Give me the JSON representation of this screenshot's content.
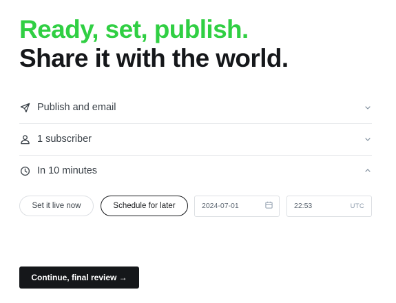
{
  "header": {
    "headline_accent": "Ready, set, publish.",
    "headline_main": "Share it with the world."
  },
  "settings": {
    "rows": [
      {
        "label": "Publish and email",
        "icon": "send-icon",
        "expanded": false
      },
      {
        "label": "1 subscriber",
        "icon": "user-icon",
        "expanded": false
      },
      {
        "label": "In 10 minutes",
        "icon": "clock-icon",
        "expanded": true
      }
    ]
  },
  "schedule": {
    "set_live_label": "Set it live now",
    "schedule_later_label": "Schedule for later",
    "selected": "Schedule for later",
    "date_value": "2024-07-01",
    "time_value": "22:53",
    "timezone": "UTC"
  },
  "actions": {
    "continue_label": "Continue, final review →"
  },
  "colors": {
    "accent": "#30cf43",
    "text": "#15171a",
    "border": "#e6e8eb"
  }
}
